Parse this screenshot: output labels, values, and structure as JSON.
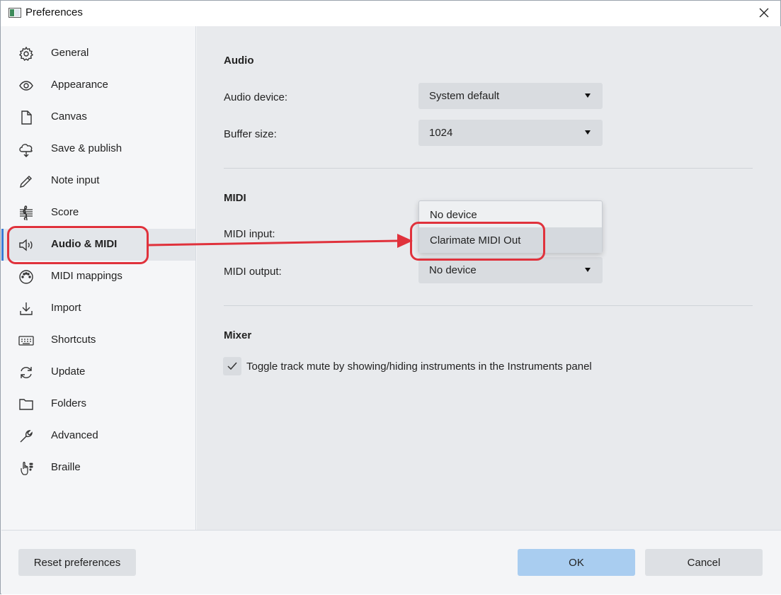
{
  "window": {
    "title": "Preferences"
  },
  "sidebar": {
    "items": [
      {
        "label": "General",
        "icon": "gear-icon"
      },
      {
        "label": "Appearance",
        "icon": "eye-icon"
      },
      {
        "label": "Canvas",
        "icon": "document-icon"
      },
      {
        "label": "Save & publish",
        "icon": "cloud-icon"
      },
      {
        "label": "Note input",
        "icon": "pencil-icon"
      },
      {
        "label": "Score",
        "icon": "treble-clef-icon"
      },
      {
        "label": "Audio & MIDI",
        "icon": "speaker-icon",
        "selected": true
      },
      {
        "label": "MIDI mappings",
        "icon": "midi-port-icon"
      },
      {
        "label": "Import",
        "icon": "download-icon"
      },
      {
        "label": "Shortcuts",
        "icon": "keyboard-icon"
      },
      {
        "label": "Update",
        "icon": "refresh-icon"
      },
      {
        "label": "Folders",
        "icon": "folder-icon"
      },
      {
        "label": "Advanced",
        "icon": "wrench-icon"
      },
      {
        "label": "Braille",
        "icon": "braille-hand-icon"
      }
    ]
  },
  "audio": {
    "title": "Audio",
    "device_label": "Audio device:",
    "device_value": "System default",
    "buffer_label": "Buffer size:",
    "buffer_value": "1024"
  },
  "midi": {
    "title": "MIDI",
    "input_label": "MIDI input:",
    "input_options": [
      "No device",
      "Clarimate MIDI Out"
    ],
    "output_label": "MIDI output:",
    "output_value": "No device"
  },
  "mixer": {
    "title": "Mixer",
    "toggle_label": "Toggle track mute by showing/hiding instruments in the Instruments panel",
    "toggle_checked": true
  },
  "footer": {
    "reset_label": "Reset preferences",
    "ok_label": "OK",
    "cancel_label": "Cancel"
  },
  "colors": {
    "annotation": "#e0323c",
    "primary_button": "#a9cdf0",
    "selection_accent": "#3a7bd5"
  }
}
